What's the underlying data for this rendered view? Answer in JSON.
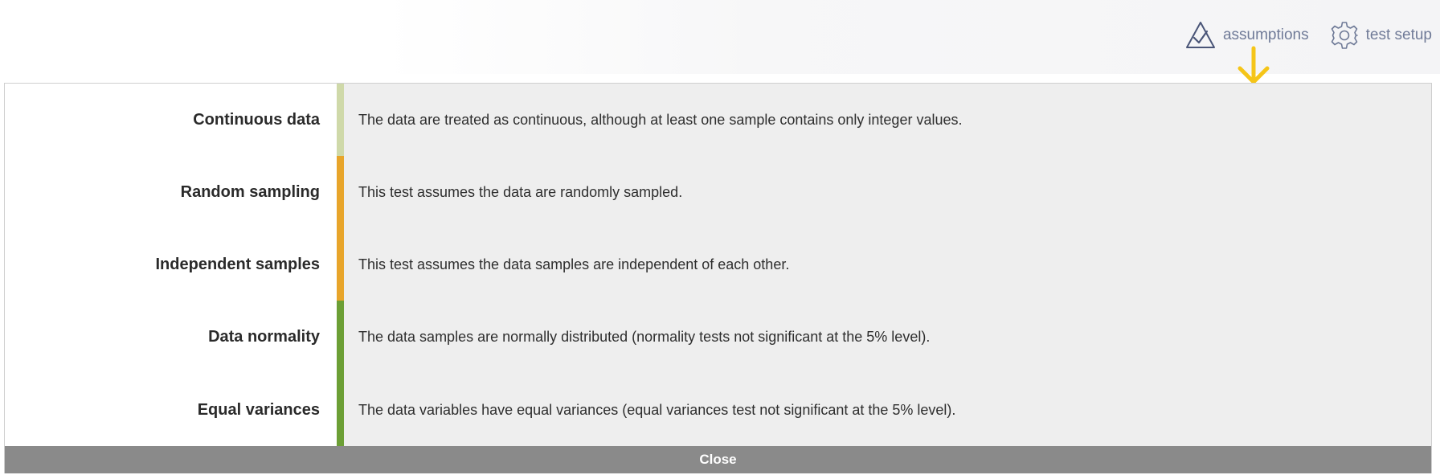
{
  "header": {
    "assumptions_label": "assumptions",
    "test_setup_label": "test setup"
  },
  "colors": {
    "light_green": "#cfd9a9",
    "amber": "#e8a52a",
    "green": "#6c9f35",
    "pointer_arrow": "#f5c518",
    "link_text": "#6f7a97"
  },
  "assumptions": [
    {
      "label": "Continuous data",
      "description": "The data are treated as continuous, although at least one sample contains only integer values.",
      "status_color": "#cfd9a9"
    },
    {
      "label": "Random sampling",
      "description": "This test assumes the data are randomly sampled.",
      "status_color": "#e8a52a"
    },
    {
      "label": "Independent samples",
      "description": "This test assumes the data samples are independent of each other.",
      "status_color": "#e8a52a"
    },
    {
      "label": "Data normality",
      "description": "The data samples are normally distributed (normality tests not significant at the 5% level).",
      "status_color": "#6c9f35"
    },
    {
      "label": "Equal variances",
      "description": "The data variables have equal variances (equal variances test not significant at the 5% level).",
      "status_color": "#6c9f35"
    }
  ],
  "close_label": "Close"
}
